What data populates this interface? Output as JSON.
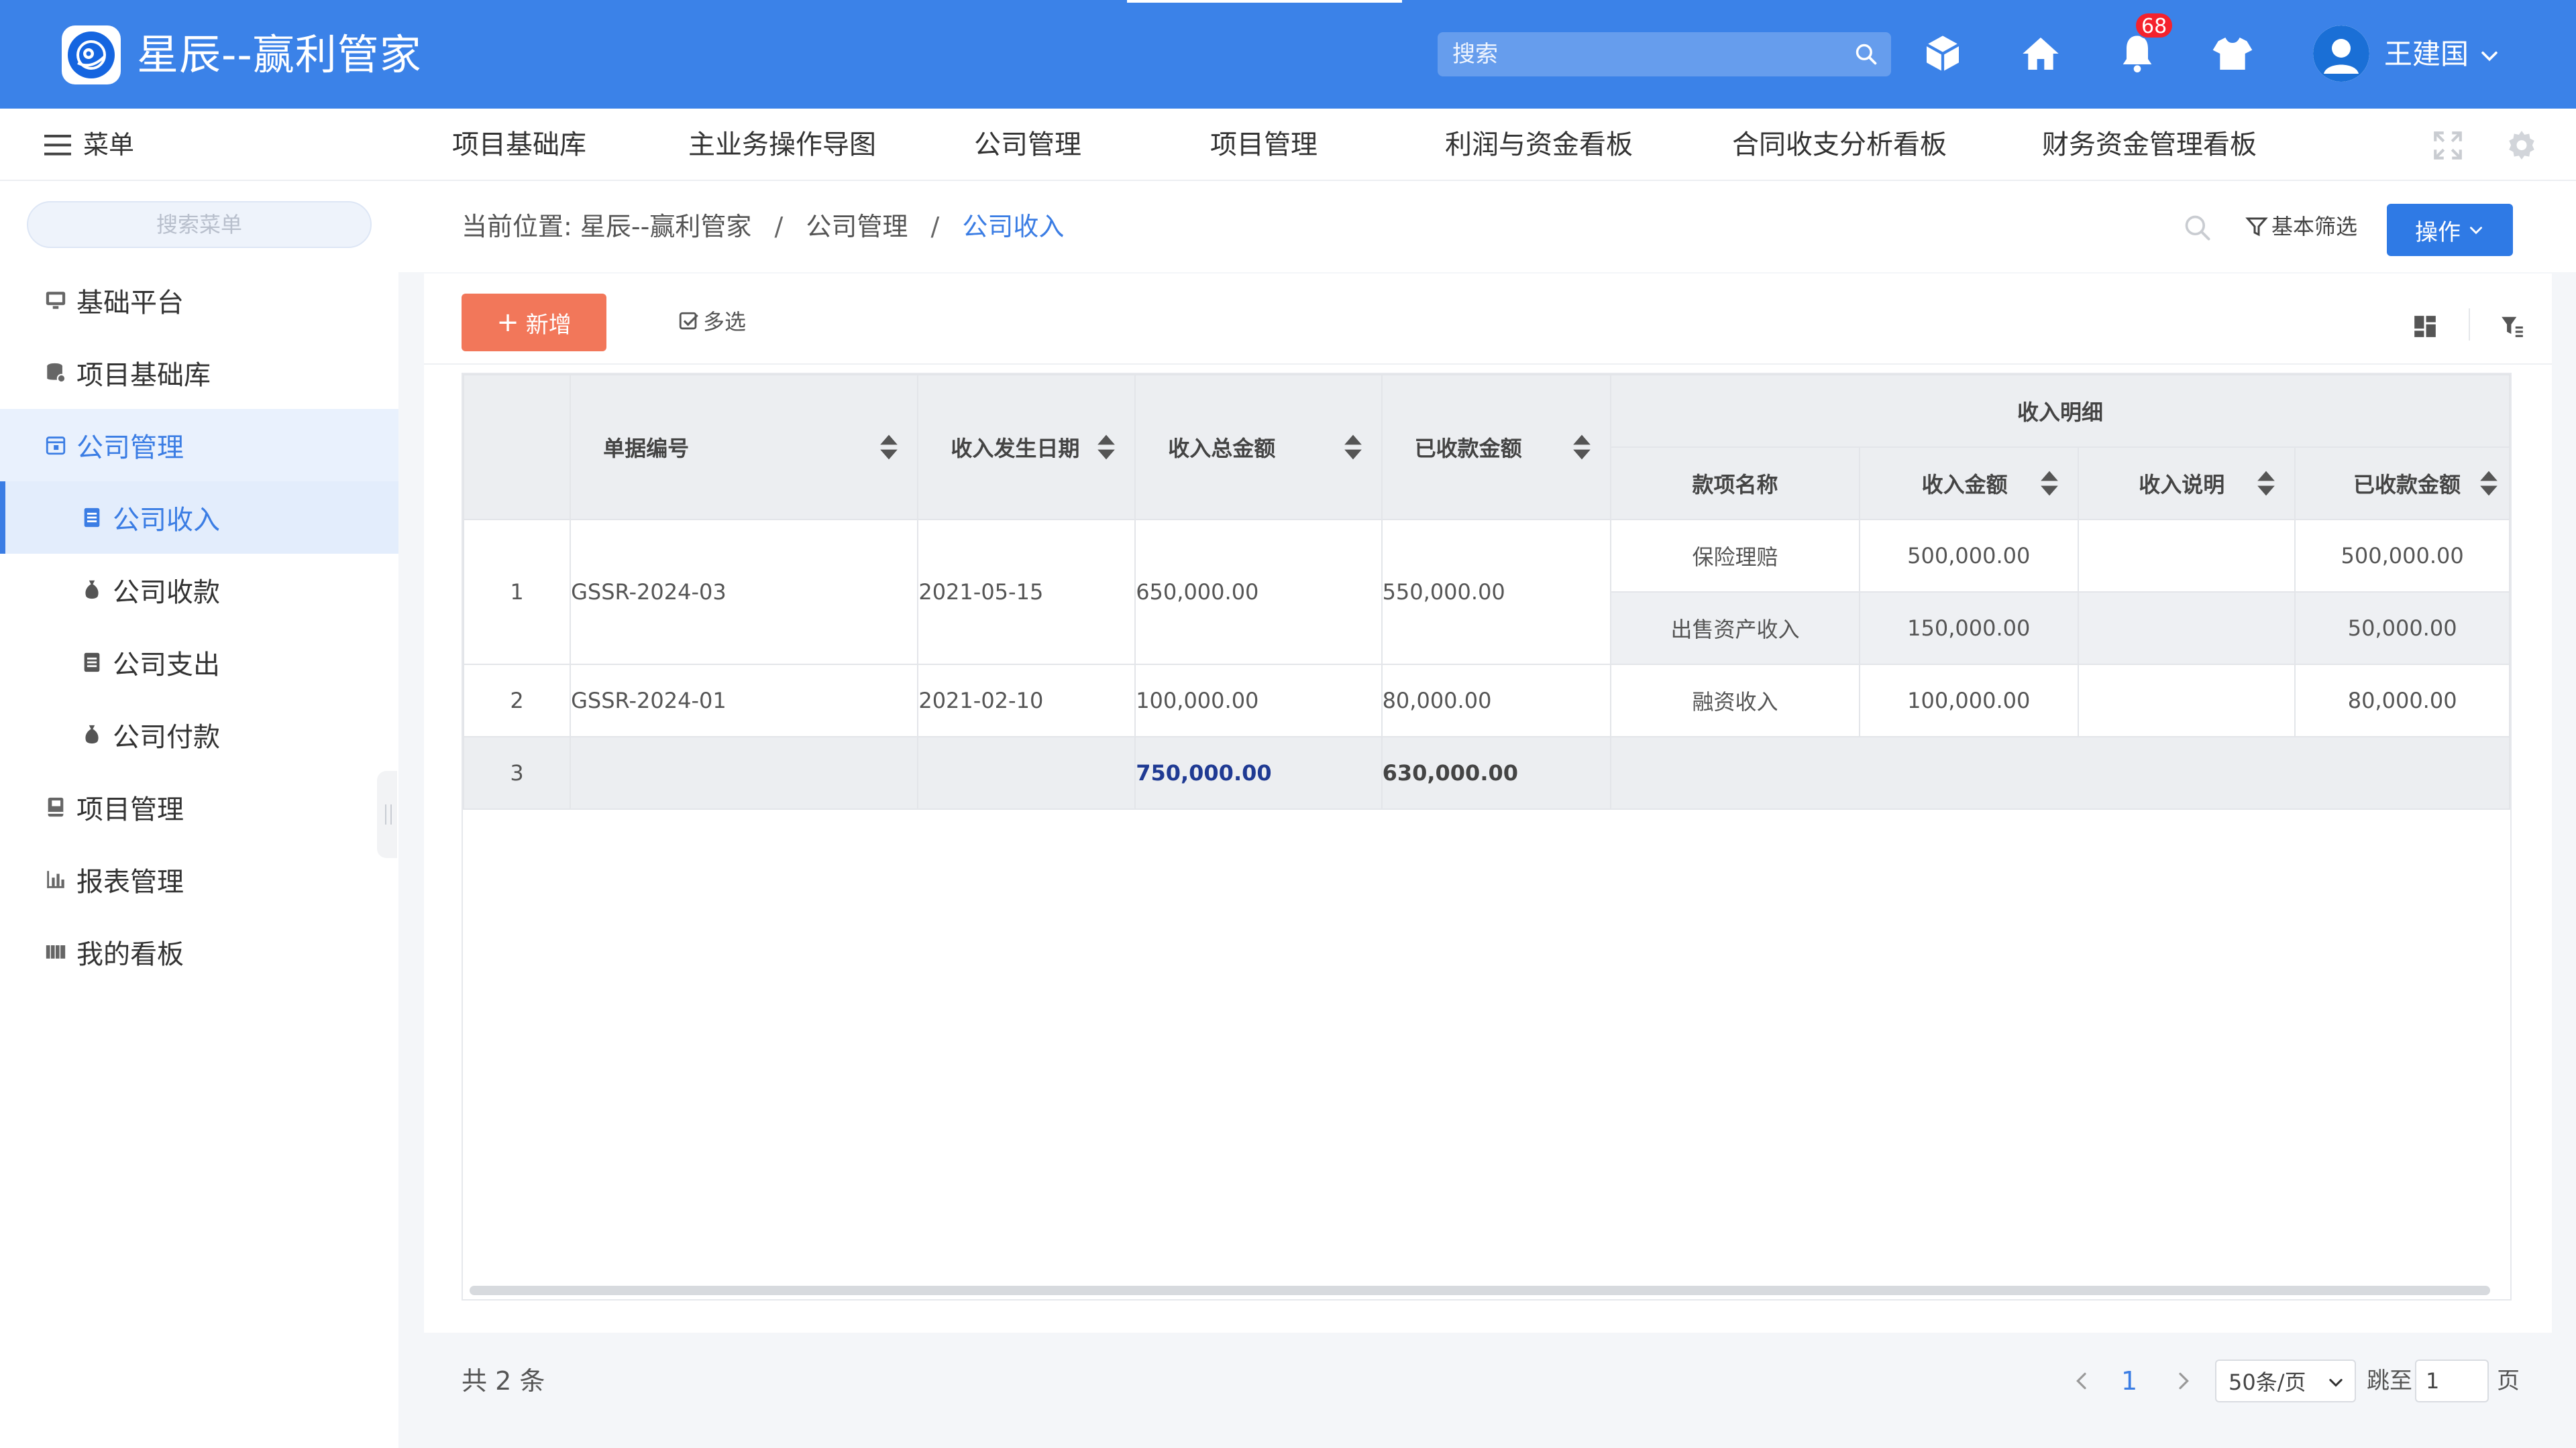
{
  "header": {
    "app_title": "星辰--赢利管家",
    "search_placeholder": "搜索",
    "notification_count": "68",
    "username": "王建国",
    "brand_color": "#3b82e8"
  },
  "nav": {
    "menu_label": "菜单",
    "items": [
      "项目基础库",
      "主业务操作导图",
      "公司管理",
      "项目管理",
      "利润与资金看板",
      "合同收支分析看板",
      "财务资金管理看板"
    ]
  },
  "sidebar": {
    "search_placeholder": "搜索菜单",
    "items": [
      {
        "label": "基础平台",
        "icon": "monitor-icon"
      },
      {
        "label": "项目基础库",
        "icon": "database-icon"
      },
      {
        "label": "公司管理",
        "icon": "calendar-icon"
      },
      {
        "label": "公司收入",
        "icon": "document-icon"
      },
      {
        "label": "公司收款",
        "icon": "money-bag-icon"
      },
      {
        "label": "公司支出",
        "icon": "document-icon"
      },
      {
        "label": "公司付款",
        "icon": "money-bag-icon"
      },
      {
        "label": "项目管理",
        "icon": "book-icon"
      },
      {
        "label": "报表管理",
        "icon": "bar-chart-icon"
      },
      {
        "label": "我的看板",
        "icon": "board-icon"
      }
    ]
  },
  "breadcrumb": {
    "prefix": "当前位置:",
    "items": [
      "星辰--赢利管家",
      "公司管理",
      "公司收入"
    ],
    "separator": "/"
  },
  "actions": {
    "basic_filter": "基本筛选",
    "operate": "操作",
    "add": "新增",
    "multi_select": "多选"
  },
  "table": {
    "headers": {
      "doc_no": "单据编号",
      "date": "收入发生日期",
      "total": "收入总金额",
      "received": "已收款金额",
      "detail_group": "收入明细",
      "item_name": "款项名称",
      "income_amount": "收入金额",
      "income_note": "收入说明",
      "detail_received": "已收款金额"
    },
    "rows": [
      {
        "index": "1",
        "doc_no": "GSSR-2024-03",
        "date": "2021-05-15",
        "total": "650,000.00",
        "received": "550,000.00",
        "details": [
          {
            "name": "保险理赔",
            "amount": "500,000.00",
            "note": "",
            "received": "500,000.00"
          },
          {
            "name": "出售资产收入",
            "amount": "150,000.00",
            "note": "",
            "received": "50,000.00"
          }
        ]
      },
      {
        "index": "2",
        "doc_no": "GSSR-2024-01",
        "date": "2021-02-10",
        "total": "100,000.00",
        "received": "80,000.00",
        "details": [
          {
            "name": "融资收入",
            "amount": "100,000.00",
            "note": "",
            "received": "80,000.00"
          }
        ]
      }
    ],
    "summary": {
      "index": "3",
      "total": "750,000.00",
      "received": "630,000.00"
    }
  },
  "footer": {
    "total_text": "共 2 条",
    "current_page": "1",
    "page_size": "50条/页",
    "jump_label": "跳至",
    "jump_value": "1",
    "page_label": "页"
  }
}
